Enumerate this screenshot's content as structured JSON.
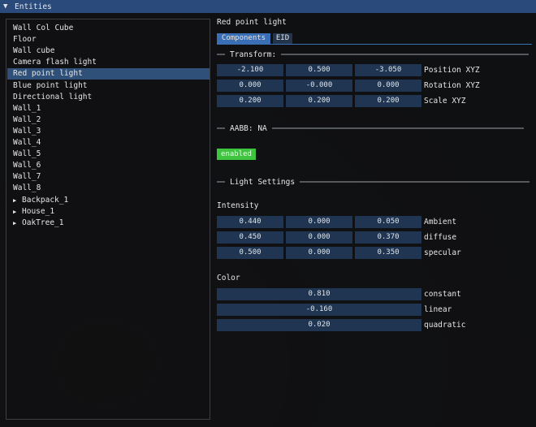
{
  "window": {
    "title": "Entities",
    "collapse_icon": "triangle-down-icon"
  },
  "entities": [
    {
      "label": "Wall Col Cube",
      "selected": false,
      "has_children": false
    },
    {
      "label": "Floor",
      "selected": false,
      "has_children": false
    },
    {
      "label": "Wall cube",
      "selected": false,
      "has_children": false
    },
    {
      "label": "Camera flash light",
      "selected": false,
      "has_children": false
    },
    {
      "label": "Red point light",
      "selected": true,
      "has_children": false
    },
    {
      "label": "Blue point light",
      "selected": false,
      "has_children": false
    },
    {
      "label": "Directional light",
      "selected": false,
      "has_children": false
    },
    {
      "label": "Wall_1",
      "selected": false,
      "has_children": false
    },
    {
      "label": "Wall_2",
      "selected": false,
      "has_children": false
    },
    {
      "label": "Wall_3",
      "selected": false,
      "has_children": false
    },
    {
      "label": "Wall_4",
      "selected": false,
      "has_children": false
    },
    {
      "label": "Wall_5",
      "selected": false,
      "has_children": false
    },
    {
      "label": "Wall_6",
      "selected": false,
      "has_children": false
    },
    {
      "label": "Wall_7",
      "selected": false,
      "has_children": false
    },
    {
      "label": "Wall_8",
      "selected": false,
      "has_children": false
    },
    {
      "label": "Backpack_1",
      "selected": false,
      "has_children": true
    },
    {
      "label": "House_1",
      "selected": false,
      "has_children": true
    },
    {
      "label": "OakTree_1",
      "selected": false,
      "has_children": true
    }
  ],
  "details": {
    "entity_name": "Red point light",
    "tabs": [
      {
        "label": "Components",
        "active": true
      },
      {
        "label": "EID",
        "active": false
      }
    ],
    "transform_header": "Transform:",
    "transform": {
      "position": {
        "label": "Position XYZ",
        "values": [
          "-2.100",
          "0.500",
          "-3.050"
        ]
      },
      "rotation": {
        "label": "Rotation XYZ",
        "values": [
          "0.000",
          "-0.000",
          "0.000"
        ]
      },
      "scale": {
        "label": "Scale XYZ",
        "values": [
          "0.200",
          "0.200",
          "0.200"
        ]
      }
    },
    "aabb_header": "AABB: NA",
    "enabled_label": "enabled",
    "light_settings_header": "Light Settings",
    "intensity_label": "Intensity",
    "intensity": {
      "ambient": {
        "label": "Ambient",
        "values": [
          "0.440",
          "0.000",
          "0.050"
        ]
      },
      "diffuse": {
        "label": "diffuse",
        "values": [
          "0.450",
          "0.000",
          "0.370"
        ]
      },
      "specular": {
        "label": "specular",
        "values": [
          "0.500",
          "0.000",
          "0.350"
        ]
      }
    },
    "color_label": "Color",
    "attenuation": {
      "constant": {
        "label": "constant",
        "value": "0.810"
      },
      "linear": {
        "label": "linear",
        "value": "-0.160"
      },
      "quadratic": {
        "label": "quadratic",
        "value": "0.020"
      }
    }
  },
  "colors": {
    "title_bar": "#294a7a",
    "selection": "#2f5078",
    "field": "#1f3551",
    "tab_active": "#3a6eb5",
    "enabled_button": "#3ec43e"
  }
}
